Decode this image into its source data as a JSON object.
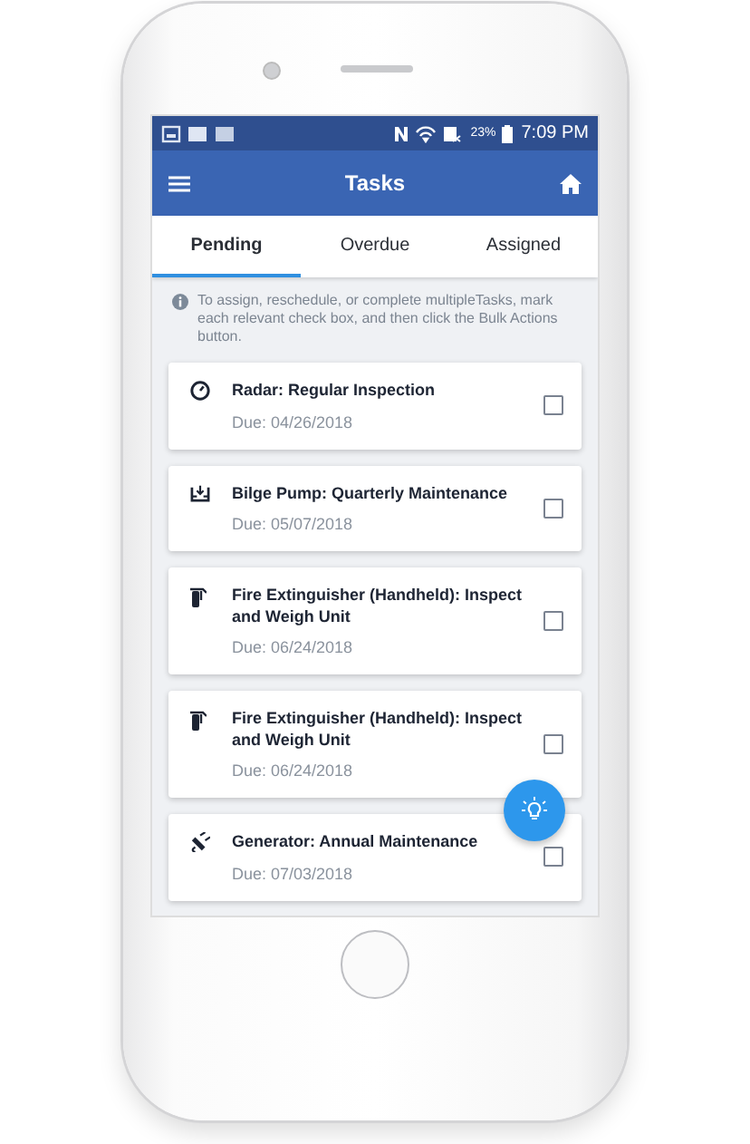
{
  "status_bar": {
    "battery_text": "23%",
    "time": "7:09 PM"
  },
  "app_bar": {
    "title": "Tasks"
  },
  "tabs": [
    {
      "label": "Pending",
      "selected": true
    },
    {
      "label": "Overdue",
      "selected": false
    },
    {
      "label": "Assigned",
      "selected": false
    }
  ],
  "info": "To assign, reschedule, or complete multipleTasks, mark each relevant check box, and then click the Bulk Actions button.",
  "tasks": [
    {
      "kind": "gauge",
      "title": "Radar: Regular Inspection",
      "due": "Due: 04/26/2018",
      "checked": false
    },
    {
      "kind": "pump",
      "title": "Bilge Pump: Quarterly Maintenance",
      "due": "Due: 05/07/2018",
      "checked": false
    },
    {
      "kind": "extinguisher",
      "title": "Fire Extinguisher (Handheld): Inspect and Weigh Unit",
      "due": "Due: 06/24/2018",
      "checked": false
    },
    {
      "kind": "extinguisher",
      "title": "Fire Extinguisher (Handheld): Inspect and Weigh Unit",
      "due": "Due: 06/24/2018",
      "checked": false
    },
    {
      "kind": "plug",
      "title": "Generator: Annual Maintenance",
      "due": "Due: 07/03/2018",
      "checked": false
    }
  ]
}
